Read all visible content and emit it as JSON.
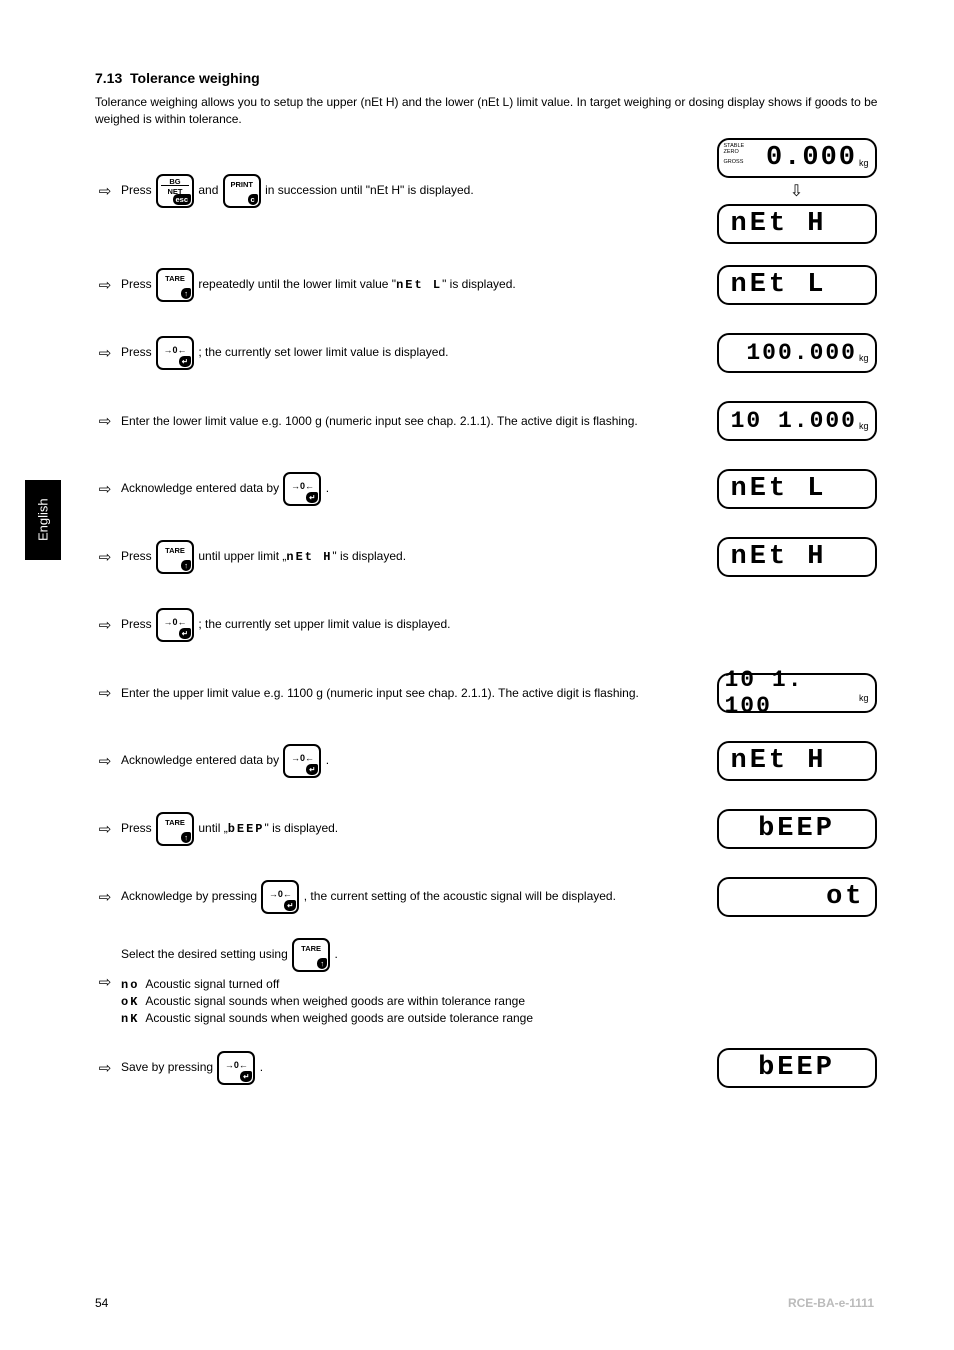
{
  "page": {
    "lang_tab": "English",
    "section_number": "7.13",
    "section_title": "Tolerance weighing",
    "intro": "Tolerance weighing allows you to setup the upper (nEt H) and the lower (nEt L) limit value. In target weighing or dosing display shows if goods to be weighed is within tolerance.",
    "page_number": "54",
    "bottom_brand": "RCE-BA-e-1111",
    "bottom_chapter": ""
  },
  "keys": {
    "bg_net": {
      "line1": "BG",
      "line2": "NET",
      "blob": "esc"
    },
    "print": {
      "line1": "PRINT",
      "blob": "c"
    },
    "tare": {
      "line1": "TARE",
      "blob": "↑"
    },
    "zero": {
      "line1": "→0←",
      "blob": "↵"
    }
  },
  "displays": {
    "d0": {
      "value": "0.000",
      "unit": "kg",
      "indicators": [
        "STABLE",
        "ZERO",
        "GROSS"
      ]
    },
    "d1": {
      "value": "nEt H"
    },
    "d2": {
      "value": "nEt L"
    },
    "d3": {
      "value": "100.000",
      "unit": "kg"
    },
    "d4": {
      "value": "10 1.000",
      "unit": "kg"
    },
    "d5": {
      "value": "nEt L"
    },
    "d6": {
      "value": "nEt H"
    },
    "d7": {
      "value": "10 1. 100",
      "unit": "kg"
    },
    "d8": {
      "value": "nEt H"
    },
    "d9": {
      "value": "bEEP"
    },
    "d10": {
      "value": "ot"
    },
    "d11": {
      "value": "bEEP"
    }
  },
  "segtext": {
    "r2": "nEt L",
    "r6": "nEt H",
    "r10": "bEEP"
  },
  "steps": {
    "r1": {
      "pre": "Press ",
      "mid": " and ",
      "post": " in succession until \"nEt H\" is displayed."
    },
    "r2": {
      "pre": "Press ",
      "post": " repeatedly until the lower limit value \"",
      "after": "\" is displayed."
    },
    "r3": {
      "pre": "Press ",
      "post": "; the currently set lower limit value is displayed."
    },
    "r4": {
      "text": "Enter the lower limit value e.g. 1000 g (numeric input see chap. 2.1.1). The active digit is flashing."
    },
    "r5": {
      "pre": "Acknowledge entered data by ",
      "post": "."
    },
    "r6": {
      "pre": "Press ",
      "mid": " until upper limit „",
      "post": "\" is displayed."
    },
    "r7": {
      "pre": "Press ",
      "post": "; the currently set upper limit value is displayed."
    },
    "r8": {
      "text": "Enter the upper limit value e.g. 1100 g (numeric input see chap. 2.1.1). The active digit is flashing."
    },
    "r9": {
      "pre": "Acknowledge entered data by ",
      "post": "."
    },
    "r10": {
      "pre": "Press ",
      "mid": " until „",
      "post": "\" is displayed."
    },
    "r11": {
      "pre": "Acknowledge by pressing ",
      "post": ", the current setting of the acoustic signal will be displayed."
    },
    "r12": {
      "pre": "Select the desired setting using ",
      "post": "."
    },
    "r13": {
      "pre": "Save by pressing ",
      "post": "."
    }
  },
  "beep_options": {
    "no": {
      "code": "no",
      "desc": "Acoustic signal turned off"
    },
    "ok": {
      "code": "oK",
      "desc": "Acoustic signal sounds when weighed goods are within tolerance range"
    },
    "nk": {
      "code": "nK",
      "desc": "Acoustic signal sounds when weighed goods are outside tolerance range"
    }
  }
}
